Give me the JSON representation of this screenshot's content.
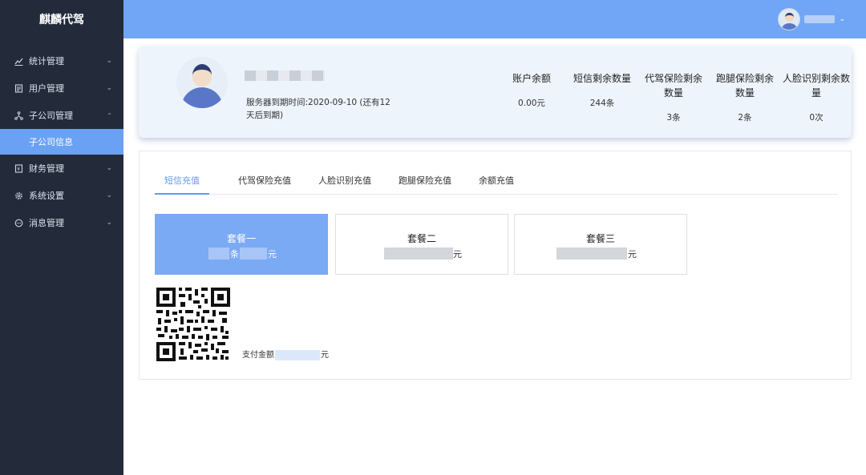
{
  "app": {
    "title": "麒麟代驾"
  },
  "sidebar": {
    "items": [
      {
        "label": "统计管理",
        "icon": "chart-line-icon",
        "expanded": false
      },
      {
        "label": "用户管理",
        "icon": "document-icon",
        "expanded": false
      },
      {
        "label": "子公司管理",
        "icon": "branch-icon",
        "expanded": true,
        "children": [
          {
            "label": "子公司信息",
            "active": true
          }
        ]
      },
      {
        "label": "财务管理",
        "icon": "ledger-icon",
        "expanded": false
      },
      {
        "label": "系统设置",
        "icon": "gear-icon",
        "expanded": false
      },
      {
        "label": "消息管理",
        "icon": "chat-icon",
        "expanded": false
      }
    ]
  },
  "header": {
    "user_menu_chevron": "⌄"
  },
  "profile": {
    "server_expire": "服务器到期时间:2020-09-10 (还有12天后到期)",
    "stats": [
      {
        "label": "账户余额",
        "value": "0.00元"
      },
      {
        "label": "短信剩余数量",
        "value": "244条"
      },
      {
        "label": "代驾保险剩余数量",
        "value": "3条"
      },
      {
        "label": "跑腿保险剩余数量",
        "value": "2条"
      },
      {
        "label": "人脸识别剩余数量",
        "value": "0次"
      }
    ]
  },
  "recharge": {
    "tabs": [
      {
        "label": "短信充值",
        "active": true
      },
      {
        "label": "代驾保险充值",
        "active": false
      },
      {
        "label": "人脸识别充值",
        "active": false
      },
      {
        "label": "跑腿保险充值",
        "active": false
      },
      {
        "label": "余额充值",
        "active": false
      }
    ],
    "packages": [
      {
        "name": "套餐一",
        "unit_tail": "条",
        "currency": "元",
        "selected": true
      },
      {
        "name": "套餐二",
        "currency": "元",
        "selected": false
      },
      {
        "name": "套餐三",
        "currency": "元",
        "selected": false
      }
    ],
    "pay_label": "支付金额",
    "pay_currency": "元"
  },
  "colors": {
    "sidebar_bg": "#232b3b",
    "header_bg": "#70a6f5",
    "accent": "#5f9bf2",
    "active_package": "#7baaf4"
  }
}
